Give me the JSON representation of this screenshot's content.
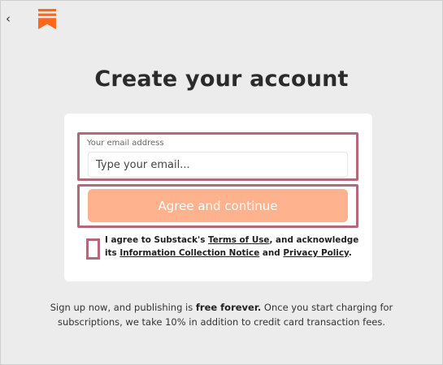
{
  "colors": {
    "background": "#ececec",
    "accent": "#ff6719",
    "button": "#ffb28d",
    "highlight": "#b06a7c"
  },
  "nav": {
    "back_icon": "chevron-left-icon",
    "back_glyph": "‹",
    "logo_icon": "substack-logo-icon"
  },
  "title": "Create your account",
  "form": {
    "email_label": "Your email address",
    "email_placeholder": "Type your email...",
    "email_value": "",
    "submit_label": "Agree and continue"
  },
  "consent": {
    "checked": false,
    "prefix": "I agree to Substack's ",
    "terms_link": "Terms of Use",
    "middle": ", and acknowledge its ",
    "notice_link": "Information Collection Notice",
    "and": " and ",
    "privacy_link": "Privacy Policy",
    "suffix": "."
  },
  "footer": {
    "part1": "Sign up now, and publishing is ",
    "bold": "free forever.",
    "part2": " Once you start charging for subscriptions, we take 10% in addition to credit card transaction fees."
  }
}
